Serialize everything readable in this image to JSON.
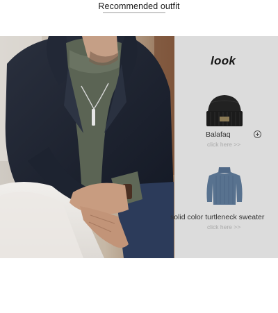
{
  "header": {
    "title": "Recommended outfit"
  },
  "look": {
    "title": "look"
  },
  "products": [
    {
      "name": "Balafaq",
      "link": "click here >>",
      "icon": "beanie-hat-icon"
    },
    {
      "name": "solid color turtleneck sweater",
      "link": "click here >>",
      "icon": "turtleneck-sweater-icon"
    }
  ],
  "colors": {
    "panel_bg": "#dcdcdc",
    "link": "#a9a9a9",
    "coat": "#1c2230",
    "sweater": "#5a6452",
    "sweater_product": "#56708f",
    "beanie": "#1b1b1b"
  }
}
